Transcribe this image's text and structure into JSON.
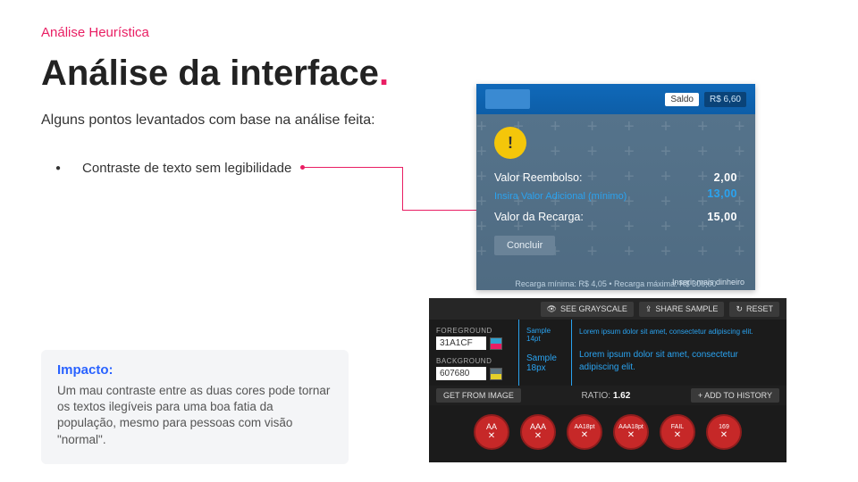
{
  "eyebrow": "Análise Heurística",
  "title": "Análise da interface",
  "title_dot": ".",
  "intro": "Alguns pontos levantados com base na análise feita:",
  "bullet": "Contraste de texto sem legibilidade",
  "impact": {
    "title": "Impacto:",
    "body": "Um mau contraste entre as duas cores pode tornar os textos ilegíveis para uma boa fatia da população, mesmo para pessoas com visão \"normal\"."
  },
  "app": {
    "saldo_label": "Saldo",
    "saldo_value": "R$ 6,60",
    "warn_glyph": "!",
    "row1_label": "Valor Reembolso:",
    "row1_value": "2,00",
    "hint": "Insira Valor Adicional (mínimo)",
    "hint_value": "13,00",
    "row2_label": "Valor da Recarga:",
    "row2_value": "15,00",
    "concluir": "Concluir",
    "insert_more": "Inserir mais dinheiro",
    "footer": "Recarga mínima: R$ 4,05 • Recarga máxima: R$ 300,00"
  },
  "checker": {
    "btn_grayscale": "SEE GRAYSCALE",
    "btn_share": "SHARE SAMPLE",
    "btn_reset": "RESET",
    "fg_label": "FOREGROUND",
    "fg_value": "31A1CF",
    "bg_label": "BACKGROUND",
    "bg_value": "607680",
    "sample_small": "Sample 14pt",
    "sample_large": "Sample 18px",
    "lorem": "Lorem ipsum dolor sit amet, consectetur adipiscing elit.",
    "get_from_image": "GET FROM IMAGE",
    "ratio_label": "RATIO:",
    "ratio_value": "1.62",
    "add_history": "+ ADD TO HISTORY",
    "badges": [
      {
        "top": "AA",
        "bottom": "✕"
      },
      {
        "top": "AAA",
        "bottom": "✕"
      },
      {
        "top": "AA18pt",
        "bottom": "✕"
      },
      {
        "top": "AAA18pt",
        "bottom": "✕"
      },
      {
        "top": "FAIL",
        "bottom": "✕"
      },
      {
        "top": "169",
        "bottom": "✕"
      }
    ]
  }
}
